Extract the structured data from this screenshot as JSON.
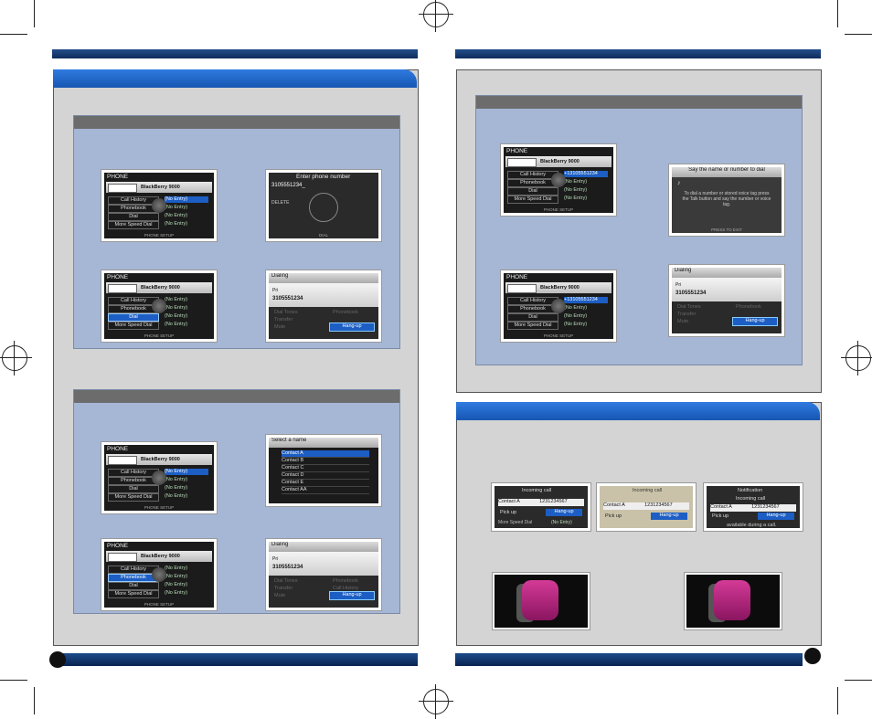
{
  "phone_screen": {
    "title": "PHONE",
    "device": "BlackBerry 9000",
    "connected": "CONNECTED PHONE",
    "items": [
      "Call History",
      "Phonebook",
      "Dial",
      "More Speed Dial"
    ],
    "entry": "(No Entry)",
    "footer": "PHONE SETUP"
  },
  "keypad_screen": {
    "title": "Enter phone number",
    "number": "3105551234_",
    "delete": "DELETE",
    "footer": "DIAL"
  },
  "dialing_screen": {
    "title": "Dialing",
    "header": "Pri",
    "number": "3105551234",
    "number2": "3105551234",
    "options": [
      "Dial Tones",
      "Phonebook",
      "Transfer",
      "Call History",
      "Mute"
    ],
    "hangup": "Hang-up"
  },
  "select_name_screen": {
    "title": "Select a name",
    "contacts": [
      "Contact A",
      "Contact B",
      "Contact C",
      "Contact D",
      "Contact E",
      "Contact AA"
    ]
  },
  "redial_screen": {
    "entry_number": "+13105551234"
  },
  "voice_screen": {
    "title": "Say the name or number to dial",
    "body": "To dial a number or stored voice tag press the Talk button and say the number or voice tag.",
    "footer": "PRESS TO EXIT"
  },
  "incoming": {
    "title": "Incoming call",
    "contact": "Contact A",
    "number": "1231234567",
    "pickup": "Pick up",
    "hangup": "Hang-up",
    "notification": "Notification",
    "note": "available during a call."
  }
}
